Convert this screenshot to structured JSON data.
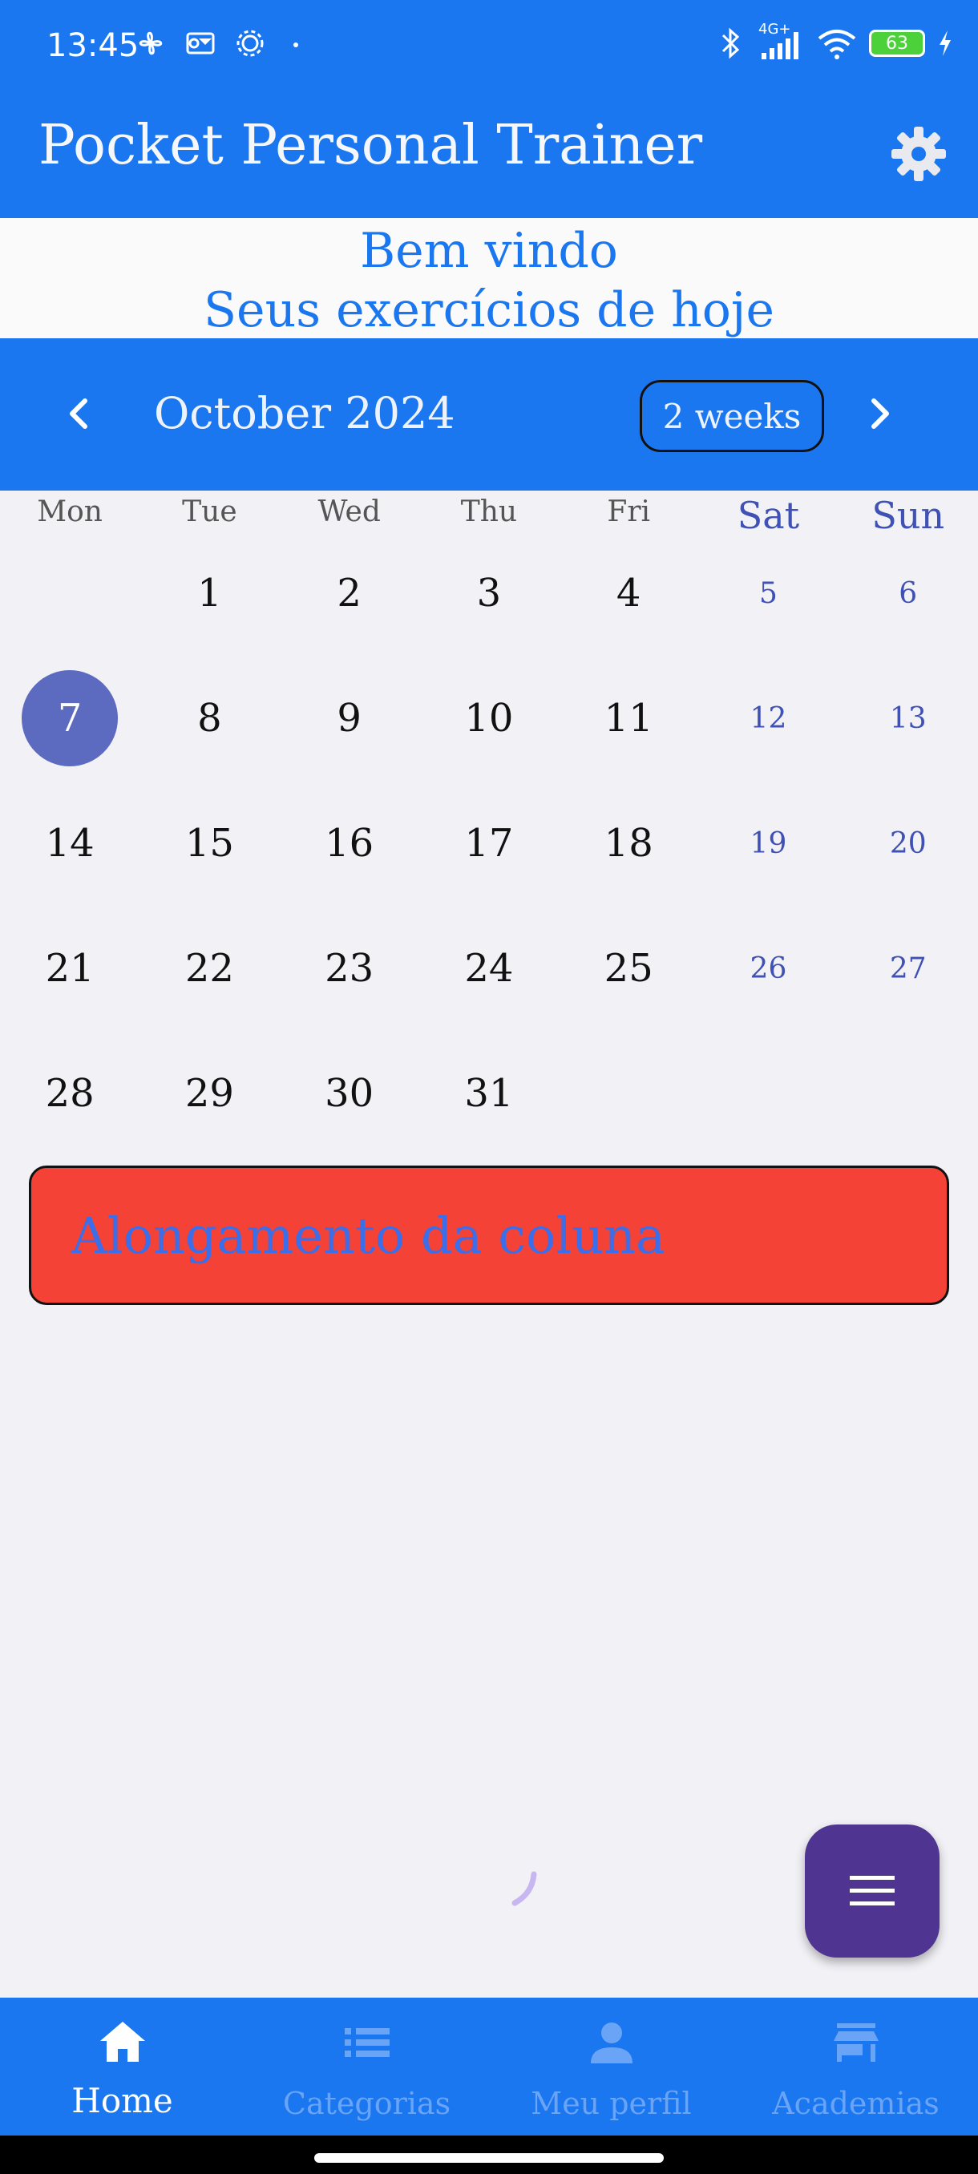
{
  "status_bar": {
    "time": "13:45",
    "network": "4G+",
    "battery": "63",
    "colors": {
      "background": "#1a77f0",
      "battery": "#4cd13b"
    }
  },
  "app_bar": {
    "title": "Pocket Personal Trainer",
    "settings_icon": "gear-icon"
  },
  "welcome": {
    "line1": "Bem vindo",
    "line2": "Seus exercícios de hoje"
  },
  "calendar": {
    "month": "October 2024",
    "format_button": "2 weeks",
    "weekdays": [
      "Mon",
      "Tue",
      "Wed",
      "Thu",
      "Fri",
      "Sat",
      "Sun"
    ],
    "weeks": [
      [
        "",
        "1",
        "2",
        "3",
        "4",
        "5",
        "6"
      ],
      [
        "7",
        "8",
        "9",
        "10",
        "11",
        "12",
        "13"
      ],
      [
        "14",
        "15",
        "16",
        "17",
        "18",
        "19",
        "20"
      ],
      [
        "21",
        "22",
        "23",
        "24",
        "25",
        "26",
        "27"
      ],
      [
        "28",
        "29",
        "30",
        "31",
        "",
        "",
        ""
      ]
    ],
    "selected_day": "7",
    "colors": {
      "selected": "#5c6bc0",
      "weekend": "#3f51b5"
    }
  },
  "event": {
    "title": "Alongamento da coluna",
    "colors": {
      "background": "#f44336",
      "text": "#3b6ee8"
    }
  },
  "fab": {
    "icon": "menu-icon",
    "color": "#4f3591"
  },
  "bottom_nav": {
    "items": [
      {
        "label": "Home",
        "icon": "home-icon",
        "active": true
      },
      {
        "label": "Categorias",
        "icon": "list-icon",
        "active": false
      },
      {
        "label": "Meu perfil",
        "icon": "person-icon",
        "active": false
      },
      {
        "label": "Academias",
        "icon": "store-icon",
        "active": false
      }
    ]
  }
}
